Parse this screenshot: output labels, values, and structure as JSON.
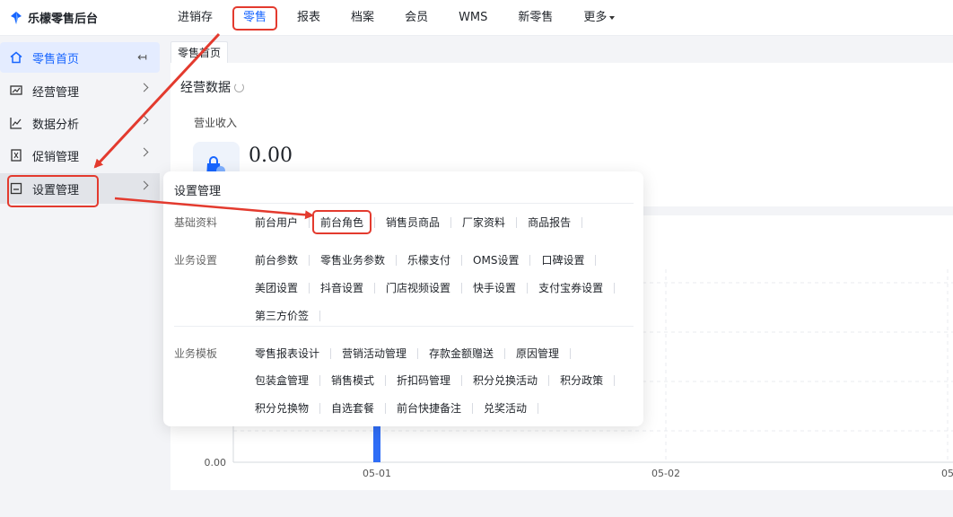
{
  "app": {
    "title": "乐檬零售后台"
  },
  "topnav": {
    "items": [
      {
        "label": "进销存",
        "active": false
      },
      {
        "label": "零售",
        "active": true
      },
      {
        "label": "报表",
        "active": false
      },
      {
        "label": "档案",
        "active": false
      },
      {
        "label": "会员",
        "active": false
      },
      {
        "label": "WMS",
        "active": false
      },
      {
        "label": "新零售",
        "active": false
      },
      {
        "label": "更多",
        "active": false,
        "has_caret": true
      }
    ]
  },
  "sidebar": {
    "items": [
      {
        "label": "零售首页",
        "icon": "home-icon"
      },
      {
        "label": "经营管理",
        "icon": "monitor-chart-icon"
      },
      {
        "label": "数据分析",
        "icon": "line-chart-icon"
      },
      {
        "label": "促销管理",
        "icon": "promo-tag-icon"
      },
      {
        "label": "设置管理",
        "icon": "settings-box-icon"
      }
    ],
    "collapse_glyph": "↤"
  },
  "tabs": [
    {
      "label": "零售首页"
    }
  ],
  "business_data": {
    "title": "经营数据",
    "revenue_label": "营业收入",
    "revenue_value": "0.00"
  },
  "settings_panel": {
    "title": "设置管理",
    "groups": [
      {
        "label": "基础资料",
        "rows": [
          [
            "前台用户",
            "前台角色",
            "销售员商品",
            "厂家资料",
            "商品报告"
          ]
        ],
        "highlighted": "前台角色"
      },
      {
        "label": "业务设置",
        "rows": [
          [
            "前台参数",
            "零售业务参数",
            "乐檬支付",
            "OMS设置",
            "口碑设置"
          ],
          [
            "美团设置",
            "抖音设置",
            "门店视频设置",
            "快手设置",
            "支付宝券设置"
          ],
          [
            "第三方价签"
          ]
        ]
      },
      {
        "label": "业务模板",
        "rows": [
          [
            "零售报表设计",
            "营销活动管理",
            "存款金额赠送",
            "原因管理"
          ],
          [
            "包装盒管理",
            "销售模式",
            "折扣码管理",
            "积分兑换活动",
            "积分政策"
          ],
          [
            "积分兑换物",
            "自选套餐",
            "前台快捷备注",
            "兑奖活动"
          ]
        ]
      }
    ]
  },
  "chart_data": {
    "type": "bar",
    "categories": [
      "05-01",
      "05-02",
      "05"
    ],
    "y_ticks": [
      "0.00"
    ],
    "values": [
      1,
      0,
      0
    ],
    "ylim": [
      0,
      1
    ],
    "grid": true,
    "bar_color": "#2f6df6"
  },
  "colors": {
    "accent": "#1765ff",
    "annotation": "#e33a2e",
    "bar": "#2f6df6"
  }
}
